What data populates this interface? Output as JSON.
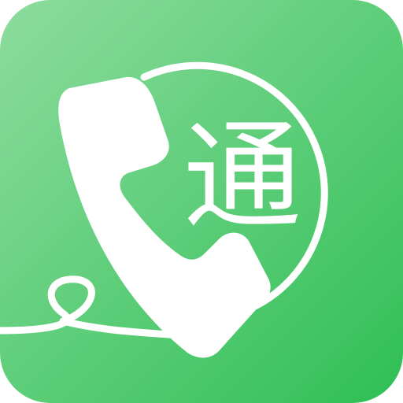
{
  "app_icon": {
    "glyph_text": "通",
    "icon": "phone-handset-with-cord-icon",
    "colors": {
      "gradient_top_left": "#8ddc9e",
      "gradient_bottom_right": "#2fbf55",
      "foreground": "#ffffff"
    }
  }
}
